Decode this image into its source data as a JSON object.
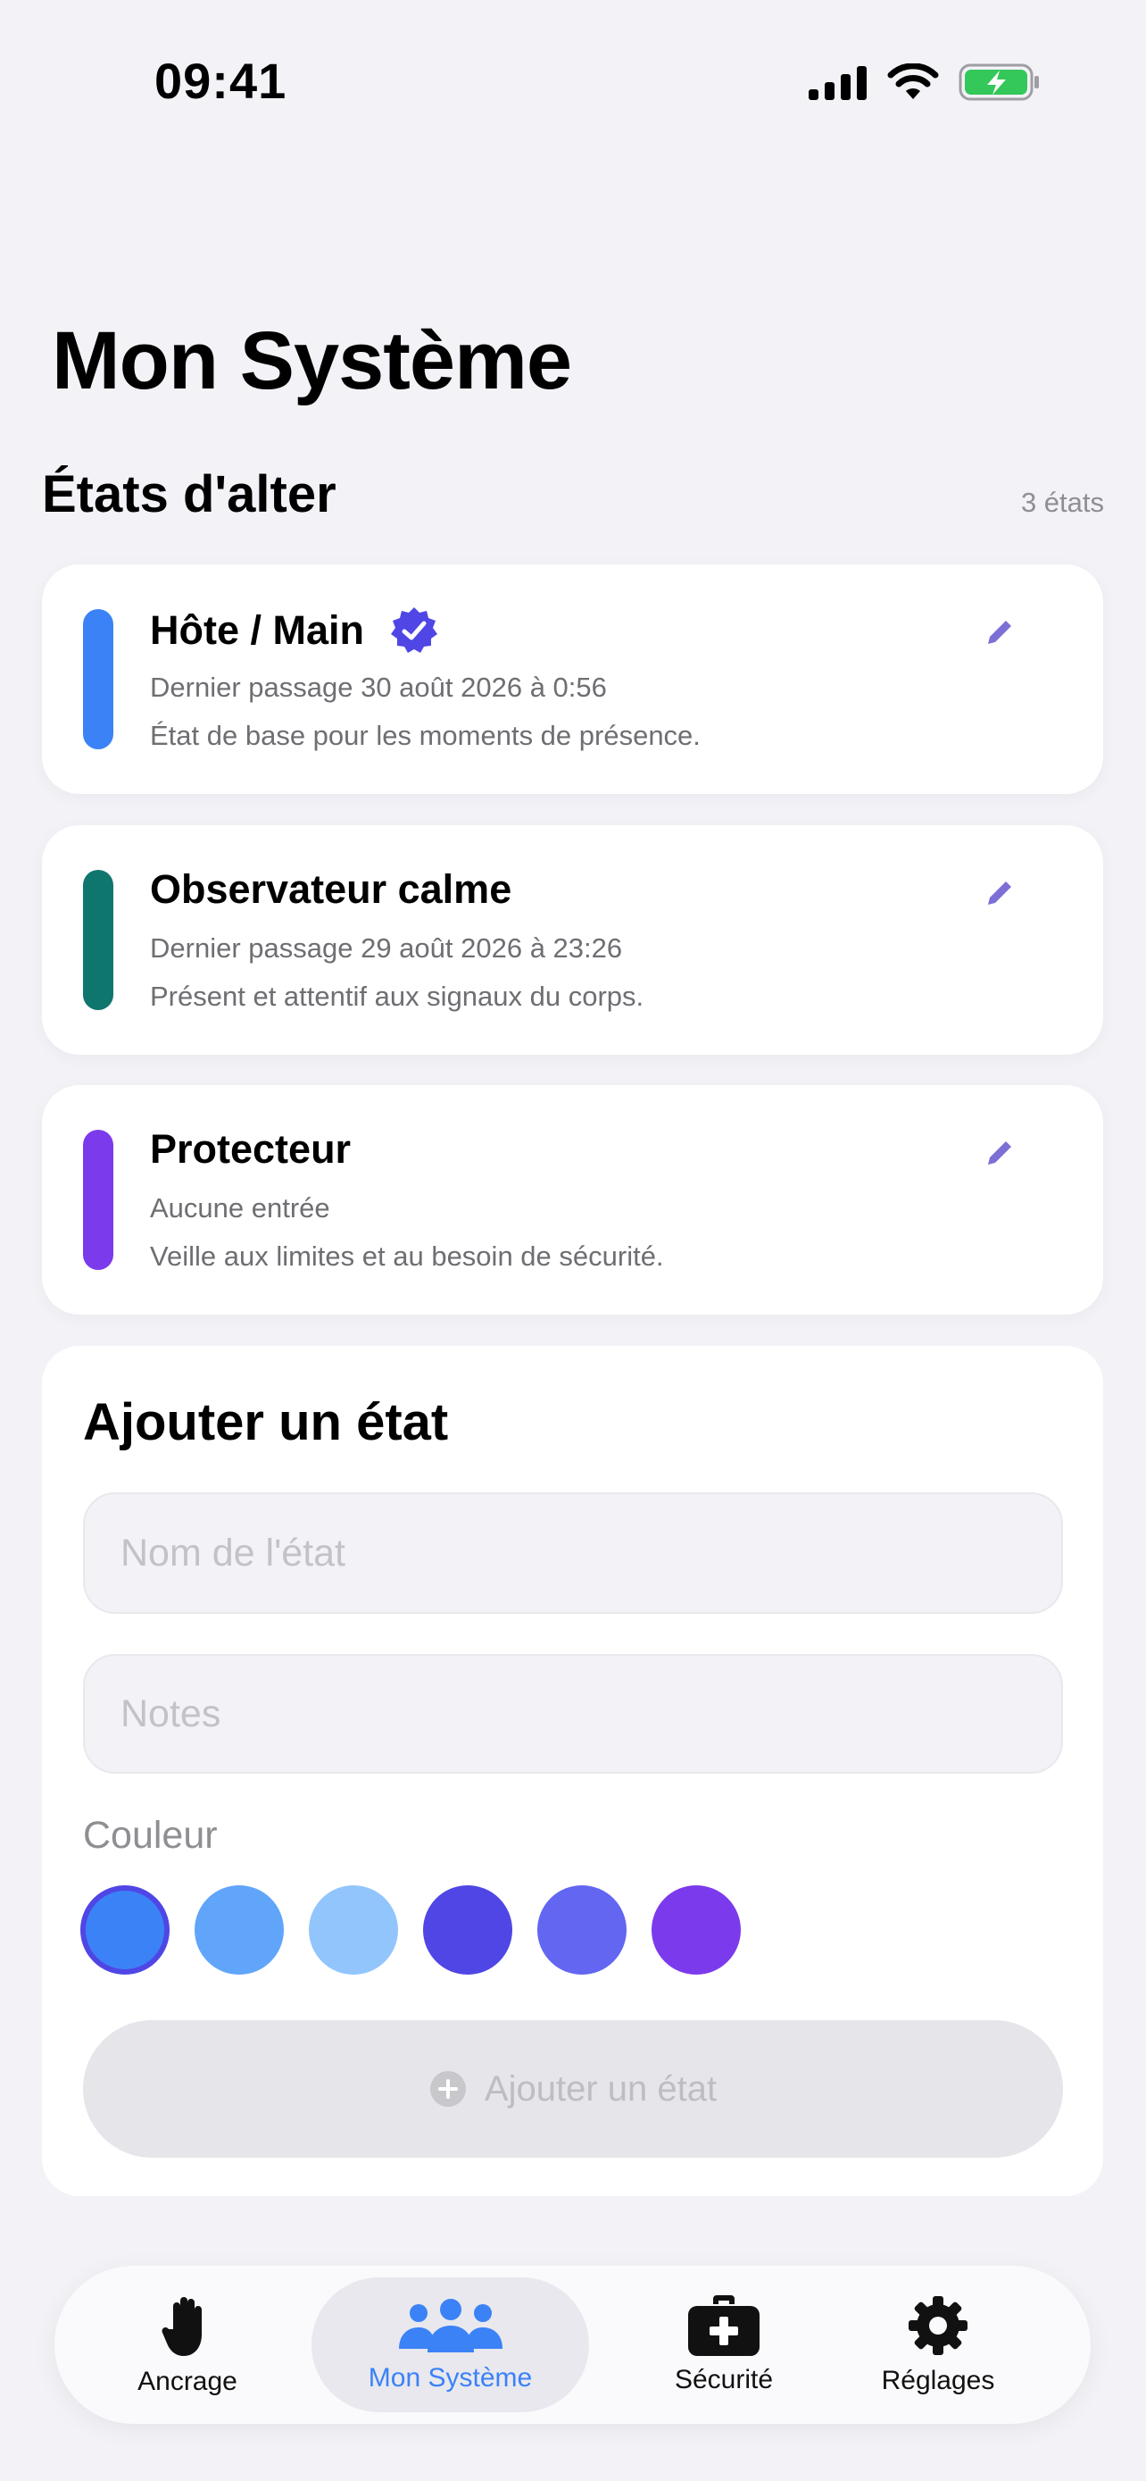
{
  "status_bar": {
    "time": "09:41"
  },
  "page": {
    "title": "Mon Système"
  },
  "states_section": {
    "title": "États d'alter",
    "count": "3 états"
  },
  "states": [
    {
      "name": "Hôte / Main",
      "last_seen": "Dernier passage 30 août 2026 à 0:56",
      "description": "État de base pour les moments de présence.",
      "color": "#3B82F6",
      "verified": true
    },
    {
      "name": "Observateur calme",
      "last_seen": "Dernier passage 29 août 2026 à 23:26",
      "description": "Présent et attentif aux signaux du corps.",
      "color": "#0F766E",
      "verified": false
    },
    {
      "name": "Protecteur",
      "last_seen": "Aucune entrée",
      "description": "Veille aux limites et au besoin de sécurité.",
      "color": "#7C3AED",
      "verified": false
    }
  ],
  "add_state": {
    "title": "Ajouter un état",
    "name_placeholder": "Nom de l'état",
    "notes_placeholder": "Notes",
    "color_label": "Couleur",
    "colors": [
      "#3B82F6",
      "#60A5FA",
      "#93C5FD",
      "#4F46E5",
      "#6366F1",
      "#7C3AED"
    ],
    "selected_color_index": 0,
    "button_label": "Ajouter un état"
  },
  "tab_bar": {
    "tabs": [
      {
        "label": "Ancrage",
        "icon": "hand-icon",
        "active": false
      },
      {
        "label": "Mon Système",
        "icon": "people-icon",
        "active": true
      },
      {
        "label": "Sécurité",
        "icon": "first-aid-kit-icon",
        "active": false
      },
      {
        "label": "Réglages",
        "icon": "gear-icon",
        "active": false
      }
    ]
  },
  "theme": {
    "accent": "#3B82F6",
    "edit_icon_color": "#7C6FD6",
    "background": "#F2F2F7"
  }
}
